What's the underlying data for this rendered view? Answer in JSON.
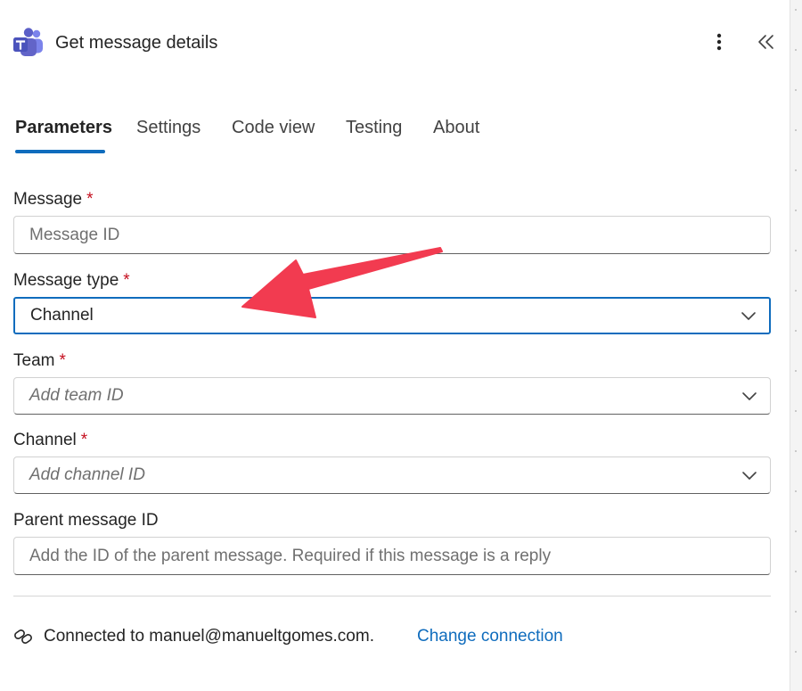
{
  "header": {
    "title": "Get message details",
    "app_icon": "teams-icon",
    "more_icon": "more-vertical-icon",
    "collapse_icon": "double-chevron-left-icon"
  },
  "tabs": [
    {
      "label": "Parameters",
      "active": true
    },
    {
      "label": "Settings",
      "active": false
    },
    {
      "label": "Code view",
      "active": false
    },
    {
      "label": "Testing",
      "active": false
    },
    {
      "label": "About",
      "active": false
    }
  ],
  "form": {
    "message": {
      "label": "Message",
      "required_mark": "*",
      "placeholder": "Message ID"
    },
    "message_type": {
      "label": "Message type",
      "required_mark": "*",
      "value": "Channel"
    },
    "team": {
      "label": "Team",
      "required_mark": "*",
      "placeholder": "Add team ID"
    },
    "channel": {
      "label": "Channel",
      "required_mark": "*",
      "placeholder": "Add channel ID"
    },
    "parent_message": {
      "label": "Parent message ID",
      "placeholder": "Add the ID of the parent message. Required if this message is a reply"
    }
  },
  "connection": {
    "icon": "link-icon",
    "text": "Connected to manuel@manueltgomes.com.",
    "change_label": "Change connection"
  },
  "colors": {
    "accent": "#0f6cbd",
    "required": "#c50f1f",
    "annotation_arrow": "#f23b50",
    "teams_purple": "#5b5fc7"
  }
}
